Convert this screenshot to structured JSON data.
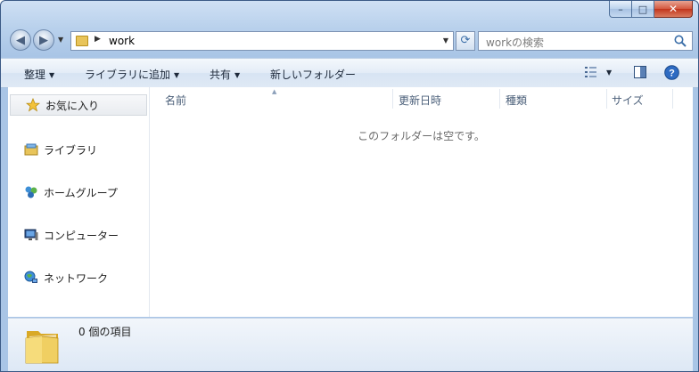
{
  "window": {
    "caption": {
      "minimize_glyph": "–",
      "maximize_glyph": "□",
      "close_glyph": "✕"
    }
  },
  "navigation": {
    "back_glyph": "◀",
    "forward_glyph": "▶",
    "address": {
      "separator_glyph": "▶",
      "path": "work",
      "dropdown_glyph": "▼"
    },
    "refresh_glyph": "⟳",
    "search": {
      "placeholder": "workの検索"
    }
  },
  "toolbar": {
    "organize": "整理",
    "add_to_library": "ライブラリに追加",
    "share": "共有",
    "new_folder": "新しいフォルダー",
    "dropdown_glyph": "▼"
  },
  "nav_pane": {
    "favorites": "お気に入り",
    "items": [
      "ライブラリ",
      "ホームグループ",
      "コンピューター",
      "ネットワーク"
    ]
  },
  "content": {
    "sort_glyph": "▲",
    "columns": [
      "名前",
      "更新日時",
      "種類",
      "サイズ"
    ],
    "empty_message": "このフォルダーは空です。"
  },
  "details": {
    "item_count": "0 個の項目"
  },
  "colors": {
    "accent": "#3b6ea8",
    "close_button": "#c2361d",
    "folder_yellow": "#e8c45a"
  },
  "icons": [
    "folder-icon",
    "search-icon",
    "view-icon",
    "preview-pane-icon",
    "help-icon",
    "star-icon",
    "library-icon",
    "homegroup-icon",
    "computer-icon",
    "network-icon"
  ]
}
